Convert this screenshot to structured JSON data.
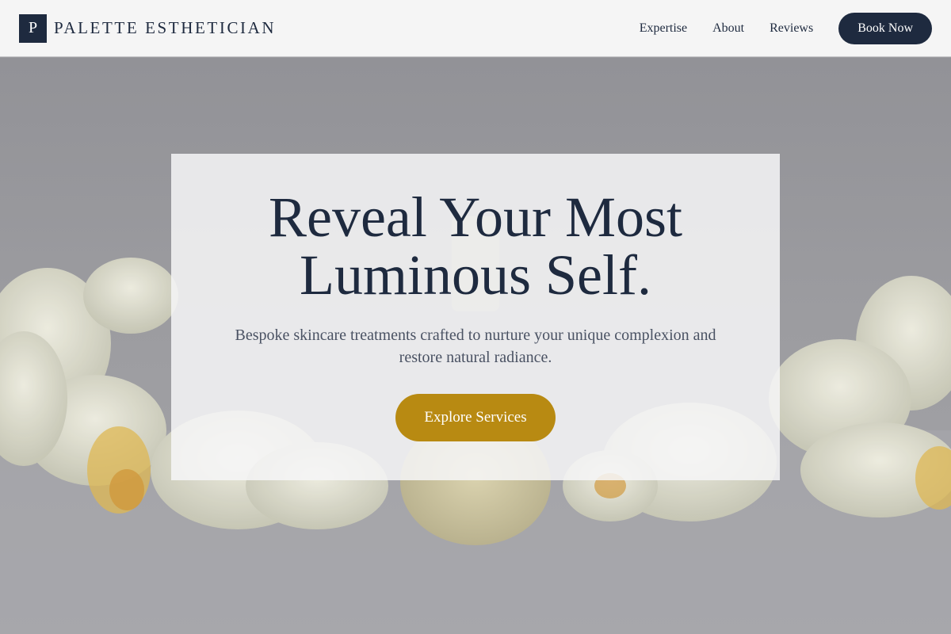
{
  "brand": {
    "mark": "P",
    "name": "PALETTE ESTHETICIAN"
  },
  "nav": {
    "links": [
      "Expertise",
      "About",
      "Reviews"
    ],
    "cta_label": "Book Now"
  },
  "hero": {
    "title_line1": "Reveal Your Most",
    "title_line2": "Luminous Self.",
    "subtitle": "Bespoke skincare treatments crafted to nurture your unique complexion and restore natural radiance.",
    "button_label": "Explore Services",
    "background": "white orchids and serum bottle"
  },
  "colors": {
    "navy": "#1e2a3f",
    "gold": "#b88a12",
    "nav_bg": "#f5f5f5"
  }
}
